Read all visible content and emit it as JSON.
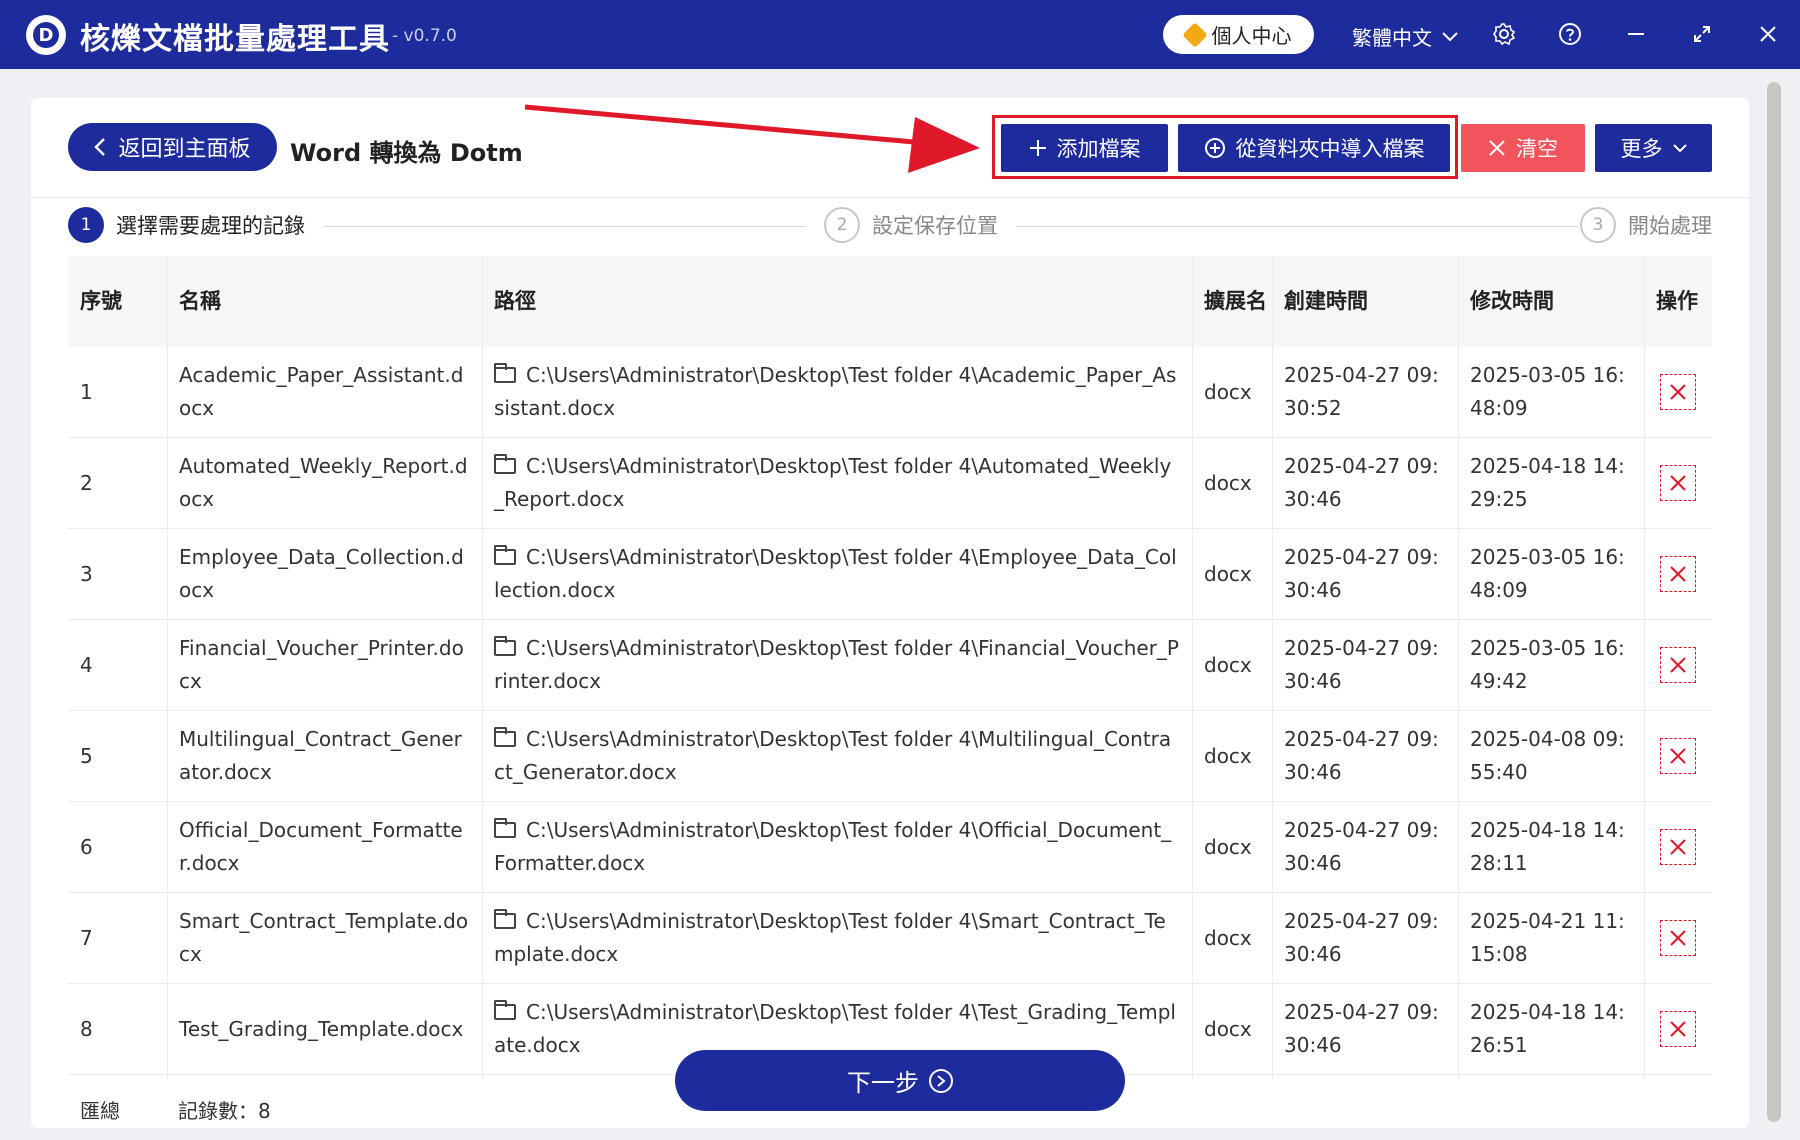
{
  "app": {
    "title": "核爍文檔批量處理工具",
    "version": "- v0.7.0",
    "logo_letter": "D",
    "personal_center": "個人中心",
    "language": "繁體中文"
  },
  "toolbar": {
    "back_label": "返回到主面板",
    "page_title": "Word 轉換為 Dotm",
    "add_files": "添加檔案",
    "import_folder": "從資料夾中導入檔案",
    "clear": "清空",
    "more": "更多"
  },
  "steps": [
    {
      "num": "1",
      "label": "選擇需要處理的記錄"
    },
    {
      "num": "2",
      "label": "設定保存位置"
    },
    {
      "num": "3",
      "label": "開始處理"
    }
  ],
  "table": {
    "headers": {
      "index": "序號",
      "name": "名稱",
      "path": "路徑",
      "ext": "擴展名",
      "created": "創建時間",
      "modified": "修改時間",
      "action": "操作"
    },
    "rows": [
      {
        "index": "1",
        "name": "Academic_Paper_Assistant.docx",
        "path": "C:\\Users\\Administrator\\Desktop\\Test folder 4\\Academic_Paper_Assistant.docx",
        "ext": "docx",
        "created": "2025-04-27 09:30:52",
        "modified": "2025-03-05 16:48:09"
      },
      {
        "index": "2",
        "name": "Automated_Weekly_Report.docx",
        "path": "C:\\Users\\Administrator\\Desktop\\Test folder 4\\Automated_Weekly_Report.docx",
        "ext": "docx",
        "created": "2025-04-27 09:30:46",
        "modified": "2025-04-18 14:29:25"
      },
      {
        "index": "3",
        "name": "Employee_Data_Collection.docx",
        "path": "C:\\Users\\Administrator\\Desktop\\Test folder 4\\Employee_Data_Collection.docx",
        "ext": "docx",
        "created": "2025-04-27 09:30:46",
        "modified": "2025-03-05 16:48:09"
      },
      {
        "index": "4",
        "name": "Financial_Voucher_Printer.docx",
        "path": "C:\\Users\\Administrator\\Desktop\\Test folder 4\\Financial_Voucher_Printer.docx",
        "ext": "docx",
        "created": "2025-04-27 09:30:46",
        "modified": "2025-03-05 16:49:42"
      },
      {
        "index": "5",
        "name": "Multilingual_Contract_Generator.docx",
        "path": "C:\\Users\\Administrator\\Desktop\\Test folder 4\\Multilingual_Contract_Generator.docx",
        "ext": "docx",
        "created": "2025-04-27 09:30:46",
        "modified": "2025-04-08 09:55:40"
      },
      {
        "index": "6",
        "name": "Official_Document_Formatter.docx",
        "path": "C:\\Users\\Administrator\\Desktop\\Test folder 4\\Official_Document_Formatter.docx",
        "ext": "docx",
        "created": "2025-04-27 09:30:46",
        "modified": "2025-04-18 14:28:11"
      },
      {
        "index": "7",
        "name": "Smart_Contract_Template.docx",
        "path": "C:\\Users\\Administrator\\Desktop\\Test folder 4\\Smart_Contract_Template.docx",
        "ext": "docx",
        "created": "2025-04-27 09:30:46",
        "modified": "2025-04-21 11:15:08"
      },
      {
        "index": "8",
        "name": "Test_Grading_Template.docx",
        "path": "C:\\Users\\Administrator\\Desktop\\Test folder 4\\Test_Grading_Template.docx",
        "ext": "docx",
        "created": "2025-04-27 09:30:46",
        "modified": "2025-04-18 14:26:51"
      }
    ],
    "summary_label": "匯總",
    "summary_count": "記錄數：8"
  },
  "footer": {
    "next_label": "下一步"
  },
  "icons": {
    "back": "chevron-left-icon",
    "add": "plus-icon",
    "import": "plus-circle-icon",
    "clear": "close-icon",
    "more": "chevron-down-icon",
    "settings": "gear-icon",
    "help": "help-icon",
    "minimize": "minimize-icon",
    "maximize": "maximize-icon",
    "close": "close-icon",
    "folder": "folder-icon",
    "delete": "delete-icon",
    "next": "chevron-right-circle-icon"
  },
  "colors": {
    "primary": "#1e2b9c",
    "danger": "#f2545b",
    "highlight": "#e0192a"
  }
}
